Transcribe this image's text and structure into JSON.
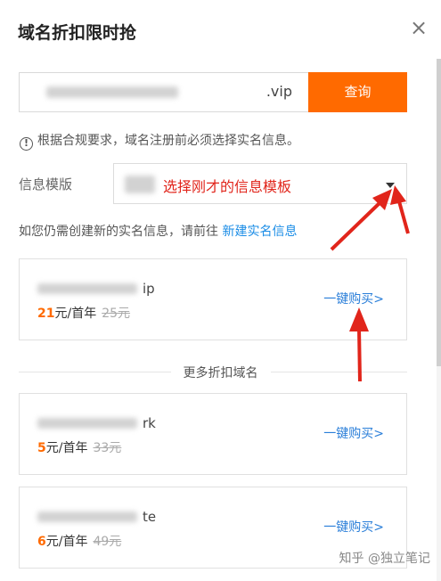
{
  "dialog": {
    "title": "域名折扣限时抢",
    "close_glyph": "×"
  },
  "search": {
    "suffix": ".vip",
    "button_label": "查询"
  },
  "notice": {
    "icon_glyph": "!",
    "text": "根据合规要求，域名注册前必须选择实名信息。"
  },
  "template": {
    "label": "信息模版",
    "annotation": "选择刚才的信息模板"
  },
  "create": {
    "text": "如您仍需创建新的实名信息，请前往",
    "link_label": "新建实名信息"
  },
  "featured": {
    "tld_visible": "ip",
    "price": "21",
    "unit": "元/首年",
    "old_price": "25元",
    "buy_label": "一键购买>"
  },
  "more_title": "更多折扣域名",
  "more_items": [
    {
      "tld_visible": "rk",
      "price": "5",
      "unit": "元/首年",
      "old_price": "33元",
      "buy_label": "一键购买>"
    },
    {
      "tld_visible": "te",
      "price": "6",
      "unit": "元/首年",
      "old_price": "49元",
      "buy_label": "一键购买>"
    }
  ],
  "watermark": "知乎 @独立笔记",
  "colors": {
    "accent": "#ff6a00",
    "link": "#1a8ce6",
    "annotation_red": "#e1251b"
  }
}
